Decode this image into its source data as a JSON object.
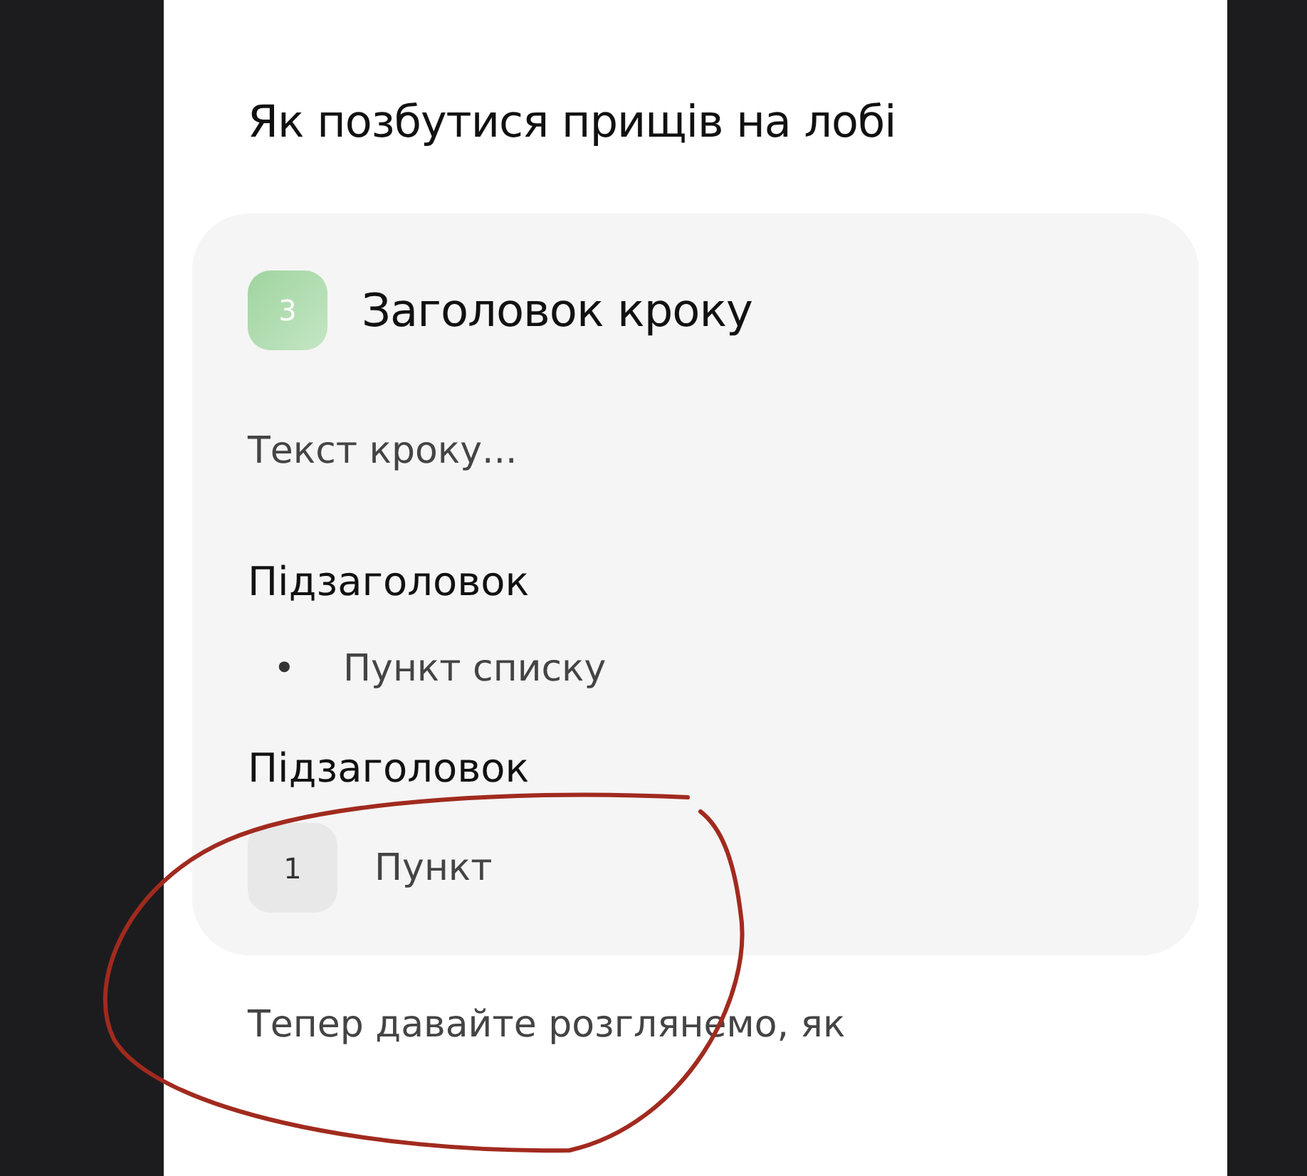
{
  "title": "Як позбутися прищів на лобі",
  "step": {
    "number": "3",
    "title": "Заголовок кроку",
    "text": "Текст кроку...",
    "sections": [
      {
        "kind": "bullets",
        "heading": "Підзаголовок",
        "items": [
          {
            "marker": "•",
            "text": "Пункт списку"
          }
        ]
      },
      {
        "kind": "numbered",
        "heading": "Підзаголовок",
        "items": [
          {
            "marker": "1",
            "text": "Пункт"
          }
        ]
      }
    ]
  },
  "after_text": "Тепер давайте розглянемо, як"
}
